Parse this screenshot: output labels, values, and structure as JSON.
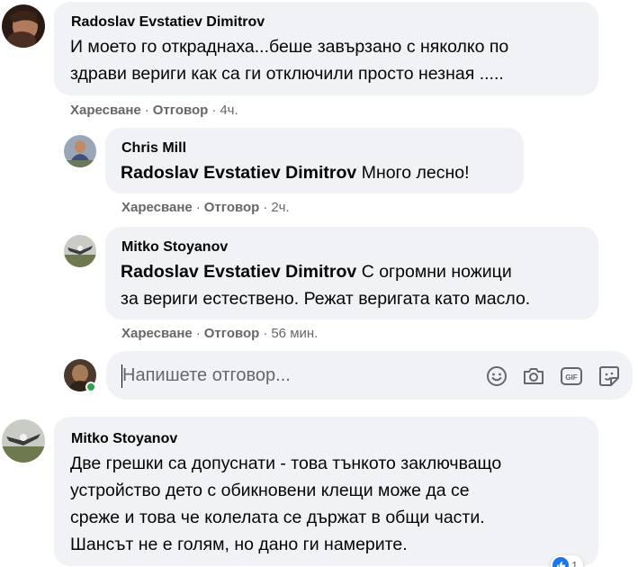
{
  "comments": [
    {
      "author": "Radoslav Evstatiev Dimitrov",
      "lines": [
        "И моето го откраднаха...беше завързано с няколко по",
        "здрави вериги как са ги отключили просто незная ....."
      ],
      "like_label": "Харесване",
      "reply_label": "Отговор",
      "time": "4ч."
    },
    {
      "author": "Chris Mill",
      "mention": "Radoslav Evstatiev Dimitrov",
      "lines": [
        " Много лесно!"
      ],
      "like_label": "Харесване",
      "reply_label": "Отговор",
      "time": "2ч."
    },
    {
      "author": "Mitko Stoyanov",
      "mention": "Radoslav Evstatiev Dimitrov",
      "lines": [
        " С огромни ножици",
        "за вериги естествено. Режат веригата като масло."
      ],
      "like_label": "Харесване",
      "reply_label": "Отговор",
      "time": "56 мин."
    },
    {
      "author": "Mitko Stoyanov",
      "lines": [
        "Две грешки са допуснати - това тънкото заключващо",
        "устройство дето с обикновени клещи може да се",
        "среже и това че колелата се държат в общи части.",
        "Шансът не е голям, но дано ги намерите."
      ],
      "reaction_count": "1"
    }
  ],
  "reply_box": {
    "placeholder": "Напишете отговор...",
    "tool_icons": [
      "emoji-icon",
      "camera-icon",
      "gif-icon",
      "sticker-icon"
    ]
  },
  "colors": {
    "bubble": "#f0f2f5",
    "secondary_text": "#65676b",
    "online": "#31a24c",
    "like_blue": "#1877f2"
  }
}
